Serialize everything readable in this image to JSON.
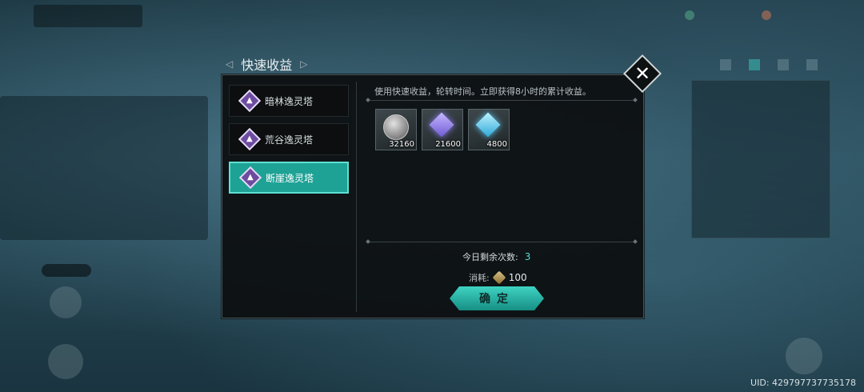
{
  "dialog": {
    "title": "快速收益",
    "description": "使用快速收益，轮转时间。立即获得8小时的累计收益。",
    "towers": [
      {
        "label": "暗林逸灵塔",
        "selected": false
      },
      {
        "label": "荒谷逸灵塔",
        "selected": false
      },
      {
        "label": "断崖逸灵塔",
        "selected": true
      }
    ],
    "rewards": [
      {
        "icon": "silver-coin-icon",
        "count": "32160"
      },
      {
        "icon": "purple-crystal-icon",
        "count": "21600"
      },
      {
        "icon": "blue-crystal-icon",
        "count": "4800"
      }
    ],
    "remaining_label": "今日剩余次数:",
    "remaining_count": "3",
    "cost_label": "消耗:",
    "cost_value": "100",
    "confirm_label": "确定"
  },
  "footer": {
    "uid": "UID: 429797737735178"
  },
  "colors": {
    "accent": "#1fa296",
    "highlight_number": "#4fd8c9"
  }
}
